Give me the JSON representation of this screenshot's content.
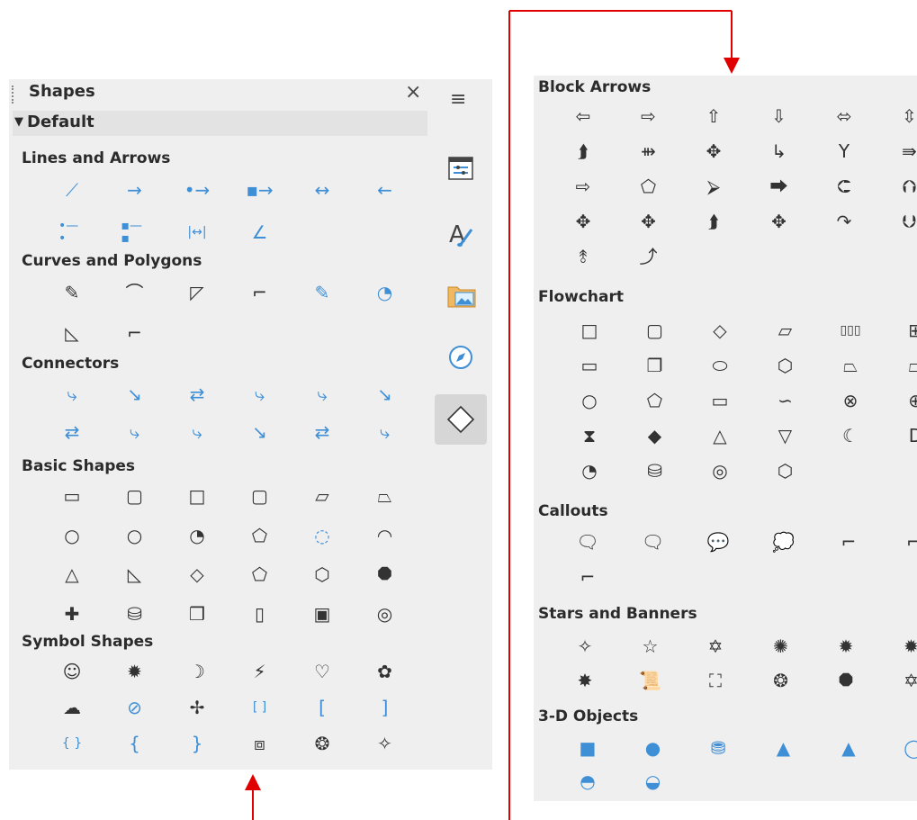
{
  "panel": {
    "title": "Shapes",
    "close_glyph": "×",
    "menu_glyph": "≡",
    "default_label": "Default"
  },
  "colors": {
    "panel_bg": "#efefef",
    "header_bg": "#e3e3e3",
    "selected_tab_bg": "#d6d6d6",
    "icon_blue": "#3f8fd6",
    "annotation_red": "#e00000"
  },
  "deck_tabs": [
    {
      "name": "properties-deck-icon"
    },
    {
      "name": "styles-deck-icon"
    },
    {
      "name": "gallery-deck-icon"
    },
    {
      "name": "navigator-deck-icon"
    },
    {
      "name": "shapes-deck-icon",
      "selected": true
    }
  ],
  "left": {
    "lines_label": "Lines and Arrows",
    "lines": [
      {
        "g": "⟋",
        "name": "line-icon"
      },
      {
        "g": "→",
        "name": "line-ends-with-arrow-icon"
      },
      {
        "g": "•→",
        "name": "line-circle-arrow-icon"
      },
      {
        "g": "▪→",
        "name": "line-square-arrow-icon"
      },
      {
        "g": "↔",
        "name": "line-arrows-icon"
      },
      {
        "g": "←",
        "name": "line-starts-with-arrow-icon"
      },
      {
        "g": "•—•",
        "name": "line-circles-icon"
      },
      {
        "g": "▪—▪",
        "name": "line-squares-icon"
      },
      {
        "g": "|↔|",
        "name": "dimension-line-icon"
      },
      {
        "g": "∠",
        "name": "angle-line-icon"
      }
    ],
    "curves_label": "Curves and Polygons",
    "curves": [
      {
        "g": "✎",
        "name": "curve-icon"
      },
      {
        "g": "⌒",
        "name": "freeform-line-icon"
      },
      {
        "g": "◸",
        "name": "polygon-icon"
      },
      {
        "g": "⌐",
        "name": "polygon-45-icon"
      },
      {
        "g": "✎",
        "name": "freeform-filled-icon"
      },
      {
        "g": "◔",
        "name": "curve-filled-icon"
      },
      {
        "g": "◺",
        "name": "polygon-filled-icon"
      },
      {
        "g": "⌐",
        "name": "polygon-45-filled-icon"
      }
    ],
    "connectors_label": "Connectors",
    "connectors": [
      {
        "g": "⤷",
        "name": "connector-icon"
      },
      {
        "g": "↘",
        "name": "straight-connector-icon"
      },
      {
        "g": "⇄",
        "name": "curved-connector-icon"
      },
      {
        "g": "⤷",
        "name": "line-connector-icon"
      },
      {
        "g": "⤷",
        "name": "connector-arrows-icon"
      },
      {
        "g": "↘",
        "name": "straight-connector-arrows-icon"
      },
      {
        "g": "⇄",
        "name": "curved-connector-arrows-icon"
      },
      {
        "g": "⤷",
        "name": "line-connector-arrows-icon"
      },
      {
        "g": "⤷",
        "name": "connector-circles-icon"
      },
      {
        "g": "↘",
        "name": "straight-connector-circles-icon"
      },
      {
        "g": "⇄",
        "name": "curved-connector-circles-icon"
      },
      {
        "g": "⤷",
        "name": "line-connector-circles-icon"
      }
    ],
    "basic_label": "Basic Shapes",
    "basic": [
      {
        "g": "▭",
        "name": "rectangle-icon"
      },
      {
        "g": "▢",
        "name": "rounded-rectangle-icon"
      },
      {
        "g": "□",
        "name": "square-icon"
      },
      {
        "g": "▢",
        "name": "rounded-square-icon"
      },
      {
        "g": "▱",
        "name": "parallelogram-icon"
      },
      {
        "g": "⏢",
        "name": "trapezoid-icon"
      },
      {
        "g": "○",
        "name": "ellipse-icon"
      },
      {
        "g": "○",
        "name": "circle-icon"
      },
      {
        "g": "◔",
        "name": "circle-pie-icon"
      },
      {
        "g": "⬠",
        "name": "circle-segment-icon"
      },
      {
        "g": "◌",
        "name": "arc-icon"
      },
      {
        "g": "◠",
        "name": "block-arc-icon"
      },
      {
        "g": "△",
        "name": "isosceles-triangle-icon"
      },
      {
        "g": "◺",
        "name": "right-triangle-icon"
      },
      {
        "g": "◇",
        "name": "diamond-icon"
      },
      {
        "g": "⬠",
        "name": "pentagon-icon"
      },
      {
        "g": "⬡",
        "name": "hexagon-icon"
      },
      {
        "g": "⯃",
        "name": "octagon-icon"
      },
      {
        "g": "✚",
        "name": "cross-icon"
      },
      {
        "g": "⛁",
        "name": "cylinder-icon"
      },
      {
        "g": "❒",
        "name": "cube-icon"
      },
      {
        "g": "▯",
        "name": "folded-corner-icon"
      },
      {
        "g": "▣",
        "name": "frame-icon"
      },
      {
        "g": "◎",
        "name": "ring-icon"
      }
    ],
    "symbol_label": "Symbol Shapes",
    "symbol": [
      {
        "g": "☺",
        "name": "smiley-icon"
      },
      {
        "g": "✹",
        "name": "sun-icon"
      },
      {
        "g": "☽",
        "name": "moon-icon"
      },
      {
        "g": "⚡",
        "name": "lightning-icon"
      },
      {
        "g": "♡",
        "name": "heart-icon"
      },
      {
        "g": "✿",
        "name": "flower-icon"
      },
      {
        "g": "☁",
        "name": "cloud-icon"
      },
      {
        "g": "⊘",
        "name": "prohibited-icon"
      },
      {
        "g": "✢",
        "name": "puzzle-icon"
      },
      {
        "g": "[ ]",
        "name": "bracket-pair-icon"
      },
      {
        "g": "[",
        "name": "left-bracket-icon"
      },
      {
        "g": "]",
        "name": "right-bracket-icon"
      },
      {
        "g": "{ }",
        "name": "brace-pair-icon"
      },
      {
        "g": "{",
        "name": "left-brace-icon"
      },
      {
        "g": "}",
        "name": "right-brace-icon"
      },
      {
        "g": "⧈",
        "name": "square-bevel-icon"
      },
      {
        "g": "❂",
        "name": "octagon-bevel-icon"
      },
      {
        "g": "✧",
        "name": "diamond-bevel-icon"
      }
    ]
  },
  "right": {
    "block_label": "Block Arrows",
    "block": [
      {
        "g": "⇦",
        "name": "left-arrow-icon"
      },
      {
        "g": "⇨",
        "name": "right-arrow-icon"
      },
      {
        "g": "⇧",
        "name": "up-arrow-icon"
      },
      {
        "g": "⇩",
        "name": "down-arrow-icon"
      },
      {
        "g": "⬄",
        "name": "left-right-arrow-icon"
      },
      {
        "g": "⇳",
        "name": "up-down-arrow-icon"
      },
      {
        "g": "⮭",
        "name": "up-right-arrow-icon"
      },
      {
        "g": "⇻",
        "name": "up-right-down-arrow-icon"
      },
      {
        "g": "✥",
        "name": "four-way-arrow-icon"
      },
      {
        "g": "↳",
        "name": "corner-right-arrow-icon"
      },
      {
        "g": "Y",
        "name": "split-arrow-icon"
      },
      {
        "g": "⇛",
        "name": "striped-right-arrow-icon"
      },
      {
        "g": "⇨",
        "name": "notched-right-arrow-icon"
      },
      {
        "g": "⬠",
        "name": "pentagon-arrow-icon"
      },
      {
        "g": "⮚",
        "name": "chevron-icon"
      },
      {
        "g": "⮕",
        "name": "right-arrow-callout-icon"
      },
      {
        "g": "⮈",
        "name": "left-arrow-callout-icon"
      },
      {
        "g": "⮉",
        "name": "up-arrow-callout-icon"
      },
      {
        "g": "✥",
        "name": "left-right-arrow-callout-icon"
      },
      {
        "g": "✥",
        "name": "up-down-arrow-callout-icon"
      },
      {
        "g": "⮭",
        "name": "up-right-arrow-callout-icon"
      },
      {
        "g": "✥",
        "name": "four-way-arrow-callout-icon"
      },
      {
        "g": "↷",
        "name": "circular-arrow-icon"
      },
      {
        "g": "⮋",
        "name": "down-arrow-callout-icon"
      },
      {
        "g": "⥉",
        "name": "split-round-arrow-icon"
      },
      {
        "g": "⤴",
        "name": "s-shaped-arrow-icon"
      }
    ],
    "flow_label": "Flowchart",
    "flow": [
      {
        "g": "□",
        "name": "flowchart-process-icon"
      },
      {
        "g": "▢",
        "name": "flowchart-alternate-process-icon"
      },
      {
        "g": "◇",
        "name": "flowchart-decision-icon"
      },
      {
        "g": "▱",
        "name": "flowchart-data-icon"
      },
      {
        "g": "▯▯▯",
        "name": "flowchart-predefined-process-icon"
      },
      {
        "g": "⊞",
        "name": "flowchart-internal-storage-icon"
      },
      {
        "g": "▭",
        "name": "flowchart-document-icon"
      },
      {
        "g": "❐",
        "name": "flowchart-multidocument-icon"
      },
      {
        "g": "⬭",
        "name": "flowchart-terminator-icon"
      },
      {
        "g": "⬡",
        "name": "flowchart-preparation-icon"
      },
      {
        "g": "⏢",
        "name": "flowchart-manual-input-icon"
      },
      {
        "g": "⏢",
        "name": "flowchart-manual-operation-icon"
      },
      {
        "g": "○",
        "name": "flowchart-connector-icon"
      },
      {
        "g": "⬠",
        "name": "flowchart-off-page-connector-icon"
      },
      {
        "g": "▭",
        "name": "flowchart-card-icon"
      },
      {
        "g": "∽",
        "name": "flowchart-punched-tape-icon"
      },
      {
        "g": "⊗",
        "name": "flowchart-summing-junction-icon"
      },
      {
        "g": "⊕",
        "name": "flowchart-or-icon"
      },
      {
        "g": "⧗",
        "name": "flowchart-collate-icon"
      },
      {
        "g": "◆",
        "name": "flowchart-sort-icon"
      },
      {
        "g": "△",
        "name": "flowchart-extract-icon"
      },
      {
        "g": "▽",
        "name": "flowchart-merge-icon"
      },
      {
        "g": "☾",
        "name": "flowchart-stored-data-icon"
      },
      {
        "g": "D",
        "name": "flowchart-delay-icon"
      },
      {
        "g": "◔",
        "name": "flowchart-sequential-access-icon"
      },
      {
        "g": "⛁",
        "name": "flowchart-magnetic-disc-icon"
      },
      {
        "g": "◎",
        "name": "flowchart-direct-access-icon"
      },
      {
        "g": "⬡",
        "name": "flowchart-display-icon"
      }
    ],
    "callouts_label": "Callouts",
    "callouts": [
      {
        "g": "🗨",
        "name": "rectangular-callout-icon"
      },
      {
        "g": "🗨",
        "name": "rounded-rectangular-callout-icon"
      },
      {
        "g": "💬",
        "name": "round-callout-icon"
      },
      {
        "g": "💭",
        "name": "cloud-callout-icon"
      },
      {
        "g": "⌐",
        "name": "line-callout-1-icon"
      },
      {
        "g": "⌐",
        "name": "line-callout-2-icon"
      },
      {
        "g": "⌐",
        "name": "line-callout-3-icon"
      }
    ],
    "stars_label": "Stars and Banners",
    "stars": [
      {
        "g": "✧",
        "name": "4-point-star-icon"
      },
      {
        "g": "☆",
        "name": "5-point-star-icon"
      },
      {
        "g": "✡",
        "name": "6-point-star-icon"
      },
      {
        "g": "✺",
        "name": "8-point-star-icon"
      },
      {
        "g": "✹",
        "name": "12-point-star-icon"
      },
      {
        "g": "✹",
        "name": "24-point-star-icon"
      },
      {
        "g": "✸",
        "name": "explosion-icon"
      },
      {
        "g": "📜",
        "name": "vertical-scroll-icon"
      },
      {
        "g": "⛶",
        "name": "horizontal-scroll-icon"
      },
      {
        "g": "❂",
        "name": "signet-icon"
      },
      {
        "g": "⯃",
        "name": "doorplate-icon"
      },
      {
        "g": "✡",
        "name": "concave-6-point-star-icon"
      }
    ],
    "objects_label": "3-D Objects",
    "objects": [
      {
        "g": "■",
        "name": "cube-3d-icon"
      },
      {
        "g": "●",
        "name": "sphere-3d-icon"
      },
      {
        "g": "⛃",
        "name": "cylinder-3d-icon"
      },
      {
        "g": "▲",
        "name": "cone-3d-icon"
      },
      {
        "g": "▲",
        "name": "pyramid-3d-icon"
      },
      {
        "g": "◯",
        "name": "torus-3d-icon"
      },
      {
        "g": "◓",
        "name": "shell-3d-icon"
      },
      {
        "g": "◒",
        "name": "half-sphere-3d-icon"
      }
    ]
  }
}
